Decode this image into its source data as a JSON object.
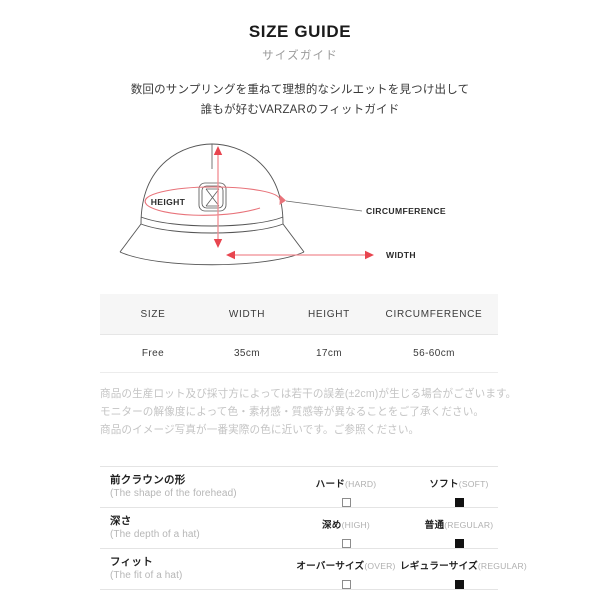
{
  "header": {
    "title_en": "SIZE GUIDE",
    "title_jp": "サイズガイド",
    "lead_line1": "数回のサンプリングを重ねて理想的なシルエットを見つけ出して",
    "lead_line2": "誰もが好むVARZARのフィットガイド"
  },
  "diagram": {
    "height_label": "HEIGHT",
    "width_label": "WIDTH",
    "circumference_label": "CIRCUMFERENCE",
    "arrow_color": "#e8737a",
    "outline_color": "#555555",
    "logo_name": "varzar-logo-emblem"
  },
  "size_table": {
    "columns": [
      "SIZE",
      "WIDTH",
      "HEIGHT",
      "CIRCUMFERENCE"
    ],
    "rows": [
      [
        "Free",
        "35cm",
        "17cm",
        "56-60cm"
      ]
    ],
    "header_background": "#f6f6f6"
  },
  "notes": [
    "商品の生産ロット及び採寸方によっては若干の誤差(±2cm)が生じる場合がございます。",
    "モニターの解像度によって色・素材感・質感等が異なることをご了承ください。",
    "商品のイメージ写真が一番実際の色に近いです。ご参照ください。"
  ],
  "attributes": [
    {
      "name_jp": "前クラウンの形",
      "name_en": "(The shape of the forehead)",
      "option_a_jp": "ハード",
      "option_a_en": "(HARD)",
      "option_a_checked": false,
      "option_b_jp": "ソフト",
      "option_b_en": "(SOFT)",
      "option_b_checked": true
    },
    {
      "name_jp": "深さ",
      "name_en": "(The depth of a hat)",
      "option_a_jp": "深め",
      "option_a_en": "(HIGH)",
      "option_a_checked": false,
      "option_b_jp": "普通",
      "option_b_en": "(REGULAR)",
      "option_b_checked": true
    },
    {
      "name_jp": "フィット",
      "name_en": "(The fit of a hat)",
      "option_a_jp": "オーバーサイズ",
      "option_a_en": "(OVER)",
      "option_a_checked": false,
      "option_b_jp": "レギュラーサイズ",
      "option_b_en": "(REGULAR)",
      "option_b_checked": true
    }
  ]
}
